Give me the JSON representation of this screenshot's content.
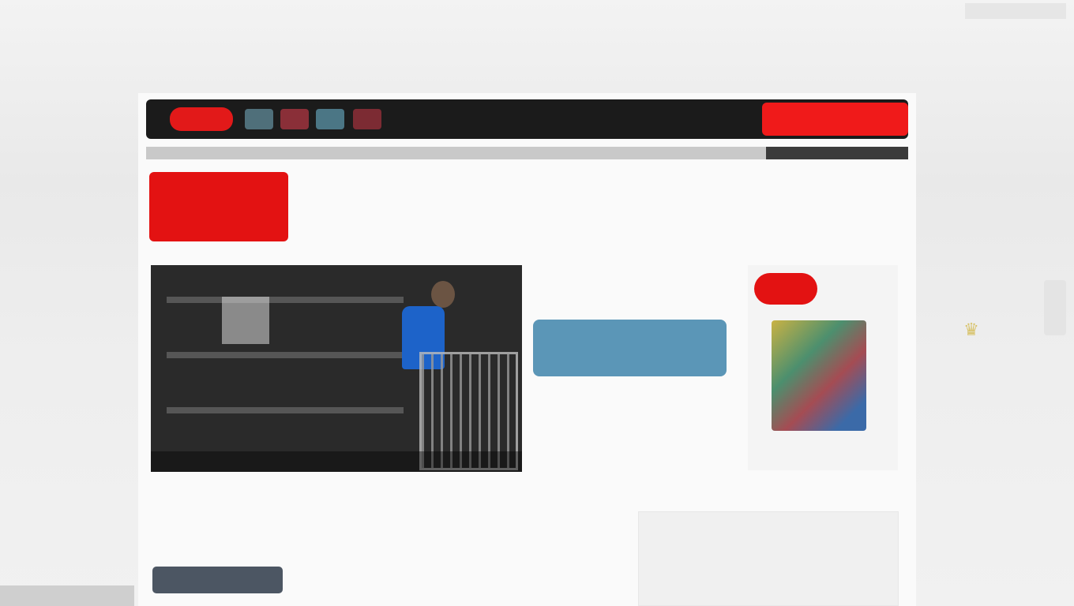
{
  "masthead": {
    "title": "",
    "subtitle": "",
    "corner": ""
  },
  "topbar": {
    "ticker": "",
    "cta": ""
  },
  "brand": {
    "line1": "",
    "line2": ""
  },
  "nav": [],
  "hero": {
    "caption": ""
  },
  "headlines": {
    "item1_title": "",
    "item1_sub": "",
    "feature": "",
    "item2_title": "",
    "item2_sub": "",
    "item3_title": "",
    "item3_sub": ""
  },
  "promo": {
    "badge": "",
    "title": "",
    "meta": ""
  },
  "side_logo": {
    "word": ""
  },
  "left_col": {
    "line1": "",
    "line2": "",
    "line3": ""
  },
  "article": {
    "kicker": "",
    "date": "",
    "line1": "",
    "line2": "",
    "line3": ""
  },
  "box": {
    "heading": "",
    "text": ""
  },
  "colors": {
    "brand_red": "#e31212",
    "feature_blue": "#5b96b7",
    "topbar_dark": "#1b1b1b"
  },
  "icons": [
    "crown-icon"
  ]
}
